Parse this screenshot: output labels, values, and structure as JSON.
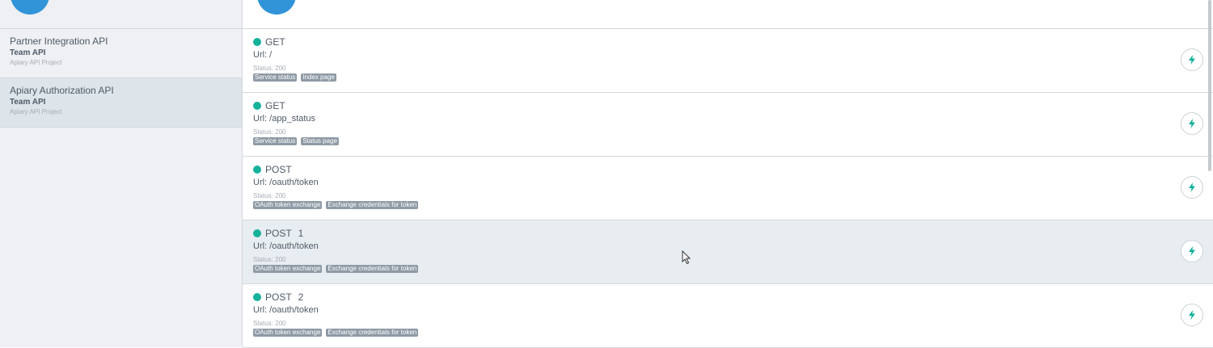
{
  "sidebar": {
    "projects": [
      {
        "name": "Partner Integration API",
        "team": "Team API",
        "sub": "Apiary API Project"
      },
      {
        "name": "Apiary Authorization API",
        "team": "Team API",
        "sub": "Apiary API Project"
      }
    ]
  },
  "requests": [
    {
      "method": "GET",
      "count": "",
      "url": "Url: /",
      "status": "Status: 200",
      "tags": [
        "Service status",
        "Index page"
      ]
    },
    {
      "method": "GET",
      "count": "",
      "url": "Url: /app_status",
      "status": "Status: 200",
      "tags": [
        "Service status",
        "Status page"
      ]
    },
    {
      "method": "POST",
      "count": "",
      "url": "Url: /oauth/token",
      "status": "Status: 200",
      "tags": [
        "OAuth token exchange",
        "Exchange credentials for token"
      ]
    },
    {
      "method": "POST",
      "count": "1",
      "url": "Url: /oauth/token",
      "status": "Status: 200",
      "tags": [
        "OAuth token exchange",
        "Exchange credentials for token"
      ]
    },
    {
      "method": "POST",
      "count": "2",
      "url": "Url: /oauth/token",
      "status": "Status: 200",
      "tags": [
        "OAuth token exchange",
        "Exchange credentials for token"
      ]
    }
  ],
  "icons": {
    "run": "lightning-bolt-icon",
    "status_dot": "status-dot-icon"
  },
  "colors": {
    "accent": "#3194d9",
    "status_ok": "#15b29a",
    "tag_bg": "#8e9aa5",
    "selected_bg": "#dde4ea"
  }
}
